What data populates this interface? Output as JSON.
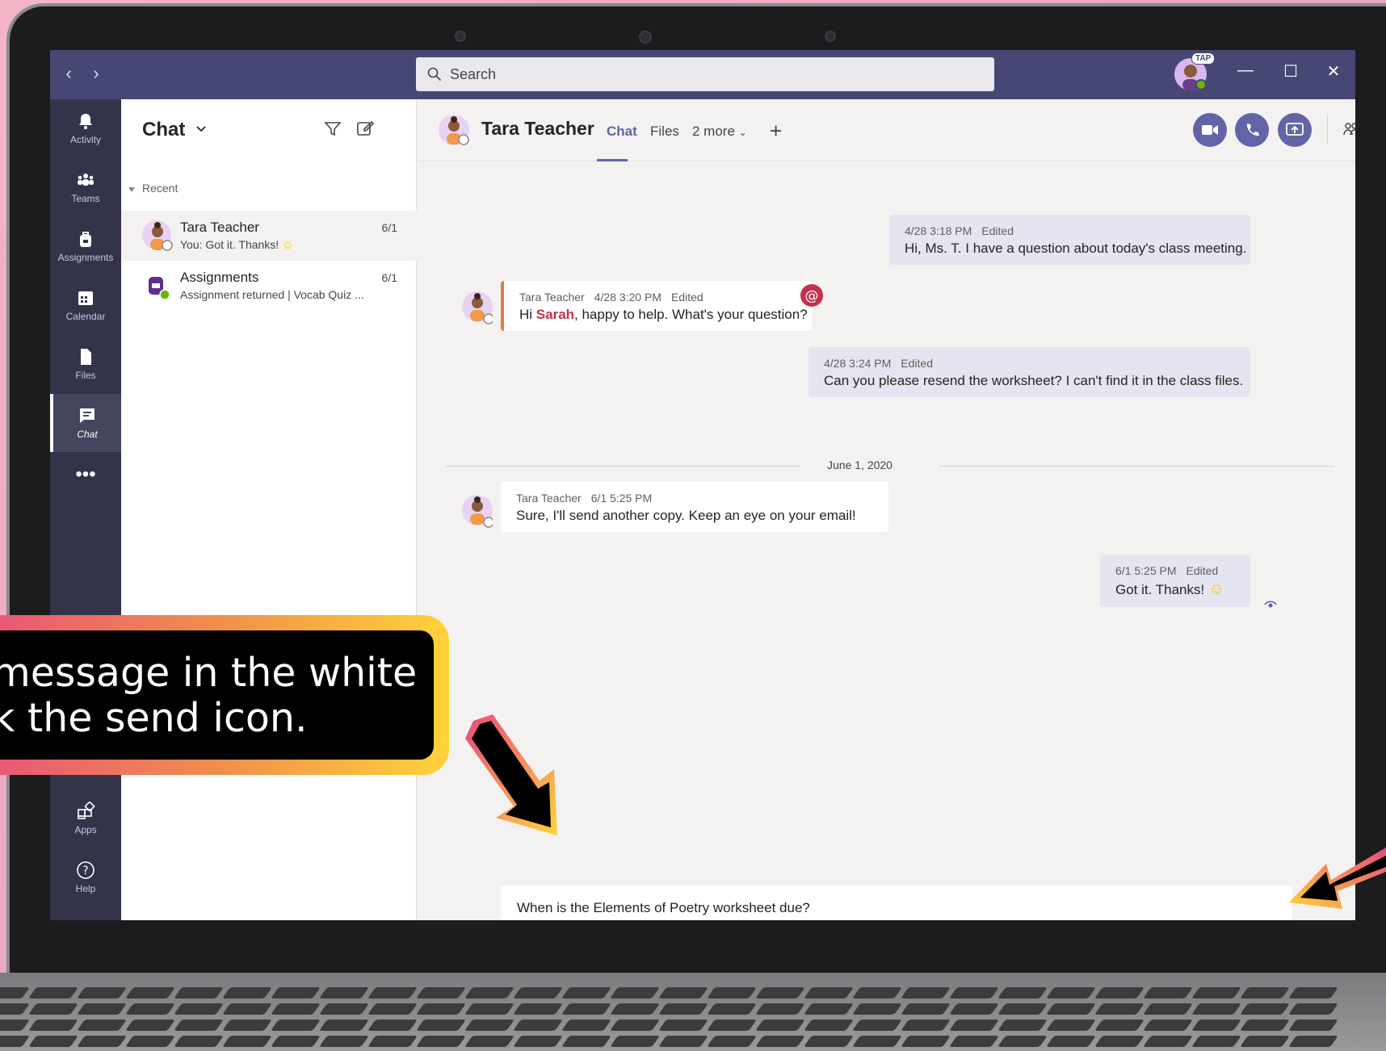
{
  "titlebar": {
    "search_placeholder": "Search",
    "user_badge": "TAP"
  },
  "rail": {
    "items": [
      {
        "label": "Activity",
        "icon": "bell-icon"
      },
      {
        "label": "Teams",
        "icon": "teams-icon"
      },
      {
        "label": "Assignments",
        "icon": "backpack-icon"
      },
      {
        "label": "Calendar",
        "icon": "calendar-icon"
      },
      {
        "label": "Files",
        "icon": "file-icon"
      },
      {
        "label": "Chat",
        "icon": "chat-icon"
      },
      {
        "label": "Apps",
        "icon": "apps-icon"
      },
      {
        "label": "Help",
        "icon": "help-icon"
      }
    ]
  },
  "chatlist": {
    "title": "Chat",
    "section_label": "Recent",
    "rows": [
      {
        "name": "Tara Teacher",
        "preview": "You: Got it. Thanks!",
        "date": "6/1"
      },
      {
        "name": "Assignments",
        "preview": "Assignment returned | Vocab Quiz ...",
        "date": "6/1"
      }
    ]
  },
  "conversation": {
    "name": "Tara Teacher",
    "tabs": [
      "Chat",
      "Files",
      "2 more"
    ],
    "messages": [
      {
        "sender": "",
        "time": "4/28 3:18 PM",
        "status": "Edited",
        "text": "Hi, Ms. T. I have a question about today's class meeting."
      },
      {
        "sender": "Tara Teacher",
        "time": "4/28 3:20 PM",
        "status": "Edited",
        "text_before": "Hi ",
        "mention": "Sarah",
        "text_after": ", happy to help. What's your question?"
      },
      {
        "sender": "",
        "time": "4/28 3:24 PM",
        "status": "Edited",
        "text": "Can you please resend the worksheet? I can't find it in the class files."
      },
      {
        "sender": "Tara Teacher",
        "time": "6/1 5:25 PM",
        "status": "",
        "text": "Sure, I'll send another copy. Keep an eye on your email!"
      },
      {
        "sender": "",
        "time": "6/1 5:25 PM",
        "status": "Edited",
        "text": "Got it. Thanks!"
      }
    ],
    "date_separator": "June 1, 2020",
    "compose_value": "When is the Elements of Poetry worksheet due?"
  },
  "callout": {
    "line1": "message in the white",
    "line2": "k the send icon."
  },
  "colors": {
    "brand": "#464775",
    "accent": "#6264a7",
    "mention": "#c4314b",
    "callout_gradient_start": "#e84a7f",
    "callout_gradient_end": "#ffd23a"
  }
}
